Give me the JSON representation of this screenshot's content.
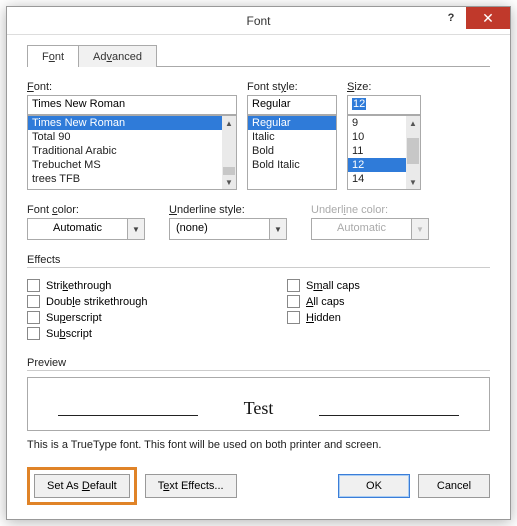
{
  "titlebar": {
    "title": "Font",
    "help": "?",
    "close": "✕"
  },
  "tabs": [
    {
      "label": "Font",
      "accesskey_html": "F<u>o</u>nt",
      "active": true
    },
    {
      "label": "Advanced",
      "accesskey_html": "Ad<u>v</u>anced",
      "active": false
    }
  ],
  "font": {
    "label": "Font:",
    "value": "Times New Roman",
    "items": [
      "Times New Roman",
      "Total 90",
      "Traditional Arabic",
      "Trebuchet MS",
      "trees TFB"
    ],
    "selected_index": 0
  },
  "style": {
    "label": "Font style:",
    "value": "Regular",
    "items": [
      "Regular",
      "Italic",
      "Bold",
      "Bold Italic"
    ],
    "selected_index": 0
  },
  "size": {
    "label": "Size:",
    "value": "12",
    "items": [
      "9",
      "10",
      "11",
      "12",
      "14"
    ],
    "selected_index": 3
  },
  "color_row": {
    "font_color_label": "Font color:",
    "font_color_value": "Automatic",
    "underline_style_label": "Underline style:",
    "underline_style_value": "(none)",
    "underline_color_label": "Underline color:",
    "underline_color_value": "Automatic"
  },
  "effects": {
    "header": "Effects",
    "left": [
      {
        "label": "Strikethrough",
        "ak": "Stri<u>k</u>ethrough"
      },
      {
        "label": "Double strikethrough",
        "ak": "Doub<u>l</u>e strikethrough"
      },
      {
        "label": "Superscript",
        "ak": "Su<u>p</u>erscript"
      },
      {
        "label": "Subscript",
        "ak": "Su<u>b</u>script"
      }
    ],
    "right": [
      {
        "label": "Small caps",
        "ak": "S<u>m</u>all caps"
      },
      {
        "label": "All caps",
        "ak": "<u>A</u>ll caps"
      },
      {
        "label": "Hidden",
        "ak": "<u>H</u>idden"
      }
    ]
  },
  "preview": {
    "header": "Preview",
    "sample": "Test",
    "info": "This is a TrueType font. This font will be used on both printer and screen."
  },
  "buttons": {
    "set_default": "Set As Default",
    "set_default_ak": "Set As <u>D</u>efault",
    "text_effects": "Text Effects...",
    "text_effects_ak": "T<u>e</u>xt Effects...",
    "ok": "OK",
    "cancel": "Cancel"
  }
}
